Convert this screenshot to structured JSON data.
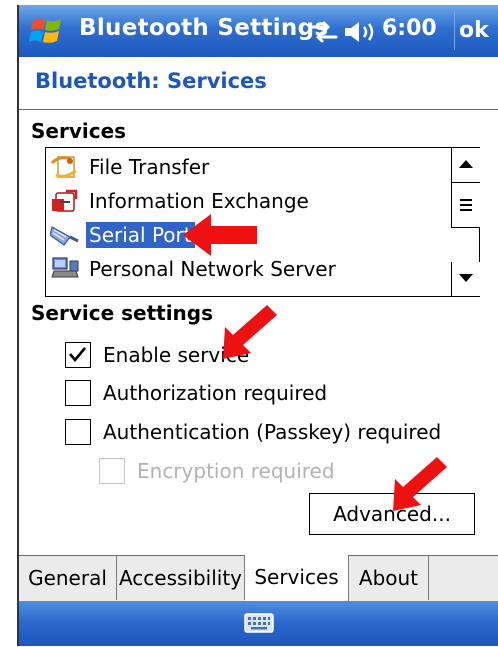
{
  "titlebar": {
    "title": "Bluetooth Settings",
    "clock": "6:00",
    "ok_label": "ok",
    "icons": [
      "windows-start-icon",
      "connectivity-sync-icon",
      "speaker-icon"
    ]
  },
  "page": {
    "heading": "Bluetooth: Services"
  },
  "services": {
    "label": "Services",
    "items": [
      {
        "label": "File Transfer",
        "icon": "file-transfer-icon",
        "selected": false
      },
      {
        "label": "Information Exchange",
        "icon": "information-exchange-icon",
        "selected": false
      },
      {
        "label": "Serial Port",
        "icon": "serial-port-icon",
        "selected": true
      },
      {
        "label": "Personal Network Server",
        "icon": "personal-network-server-icon",
        "selected": false
      }
    ]
  },
  "service_settings": {
    "label": "Service settings",
    "options": [
      {
        "label": "Enable service",
        "checked": true,
        "enabled": true
      },
      {
        "label": "Authorization required",
        "checked": false,
        "enabled": true
      },
      {
        "label": "Authentication (Passkey) required",
        "checked": false,
        "enabled": true
      },
      {
        "label": "Encryption required",
        "checked": false,
        "enabled": false
      }
    ],
    "advanced_label": "Advanced..."
  },
  "tabs": [
    {
      "label": "General",
      "active": false
    },
    {
      "label": "Accessibility",
      "active": false
    },
    {
      "label": "Services",
      "active": true
    },
    {
      "label": "About",
      "active": false
    }
  ],
  "bottombar": {
    "icon": "keyboard-icon"
  },
  "colors": {
    "titlebar_blue": "#2e6fd0",
    "heading_blue": "#1e56c0",
    "selection_blue": "#2f64c8",
    "annotation_red": "#ee1111"
  }
}
